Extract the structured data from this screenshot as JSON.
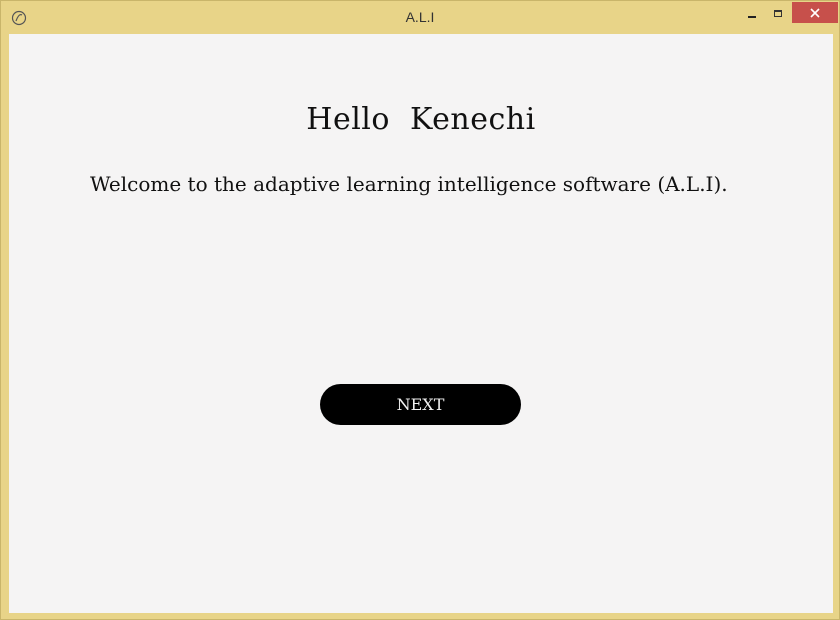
{
  "window": {
    "title": "A.L.I",
    "icon": "app-logo-icon",
    "controls": [
      "minimize-icon",
      "maximize-icon",
      "close-icon"
    ],
    "accent_color": "#e8d488",
    "close_color": "#c7504b"
  },
  "main": {
    "greeting": "Hello  Kenechi",
    "welcome_text": "Welcome to the adaptive learning intelligence software (A.L.I).",
    "next_label": "NEXT"
  }
}
